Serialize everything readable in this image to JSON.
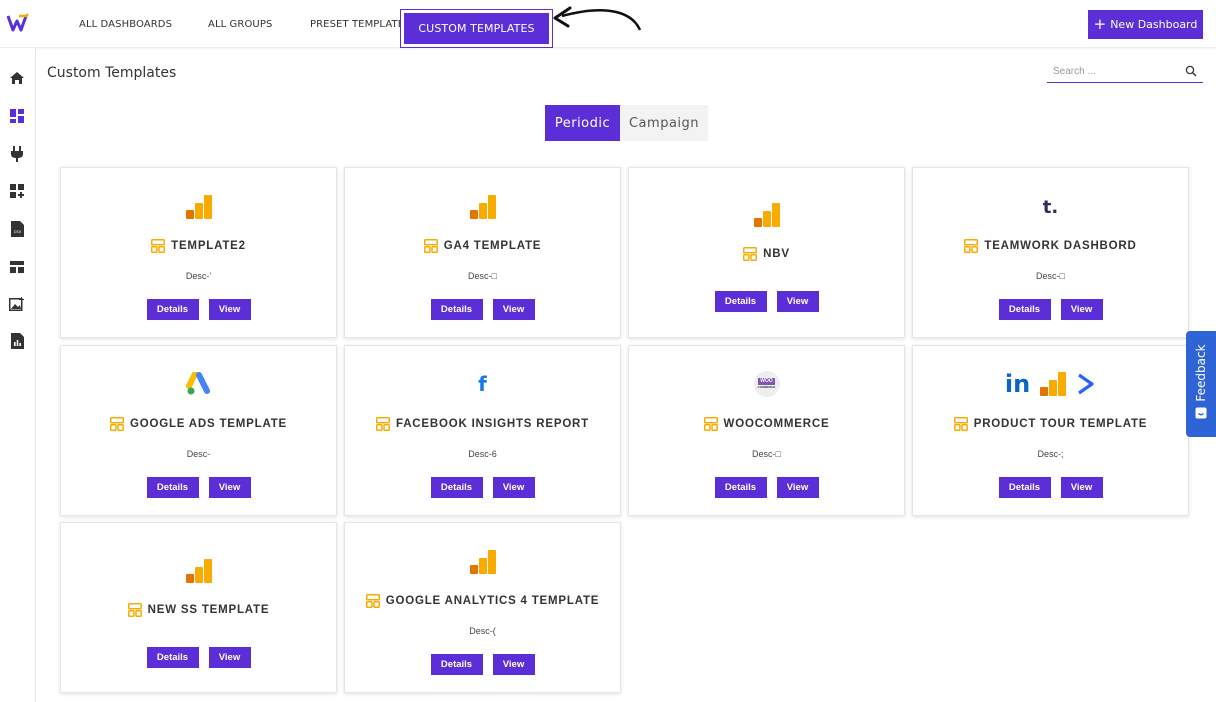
{
  "nav": {
    "tabs": [
      {
        "label": "ALL DASHBOARDS"
      },
      {
        "label": "ALL GROUPS"
      },
      {
        "label": "PRESET TEMPLATES"
      },
      {
        "label": "CUSTOM TEMPLATES"
      }
    ],
    "new_dashboard": "New Dashboard",
    "new_dashboard_icon": "+"
  },
  "sidebar": {
    "items": [
      "home-icon",
      "dashboard-icon",
      "plug-icon",
      "add-widget-icon",
      "csv-icon",
      "layout-icon",
      "gallery-icon",
      "report-icon"
    ]
  },
  "header": {
    "title": "Custom Templates",
    "search_placeholder": "Search ..."
  },
  "toggle": {
    "periodic": "Periodic",
    "campaign": "Campaign"
  },
  "buttons": {
    "details": "Details",
    "view": "View"
  },
  "cards": [
    {
      "title": "TEMPLATE2",
      "desc": "Desc-'",
      "logo": "google-analytics"
    },
    {
      "title": "GA4 TEMPLATE",
      "desc": "Desc-□",
      "logo": "google-analytics"
    },
    {
      "title": "NBV",
      "desc": "",
      "logo": "google-analytics"
    },
    {
      "title": "TEAMWORK DASHBORD",
      "desc": "Desc-□",
      "logo": "teamwork",
      "logo_text": "t."
    },
    {
      "title": "GOOGLE ADS TEMPLATE",
      "desc": "Desc-",
      "logo": "google-ads"
    },
    {
      "title": "FACEBOOK INSIGHTS REPORT",
      "desc": "Desc-6",
      "logo": "facebook",
      "logo_text": "f"
    },
    {
      "title": "WOOCOMMERCE",
      "desc": "Desc-□",
      "logo": "woocommerce",
      "logo_text": "WOO",
      "logo_subtext": "COMMERCE"
    },
    {
      "title": "PRODUCT TOUR TEMPLATE",
      "desc": "Desc-;",
      "logo": "linkedin-analytics-arrow",
      "logo_text": "in"
    },
    {
      "title": "NEW SS TEMPLATE",
      "desc": "",
      "logo": "google-analytics"
    },
    {
      "title": "GOOGLE ANALYTICS 4 TEMPLATE",
      "desc": "Desc-(",
      "logo": "google-analytics"
    }
  ],
  "feedback": {
    "label": "Feedback"
  },
  "colors": {
    "accent": "#5b2ed8",
    "analytics_orange": "#f9ab00",
    "analytics_dark": "#e37400",
    "feedback_blue": "#2f64d6"
  }
}
